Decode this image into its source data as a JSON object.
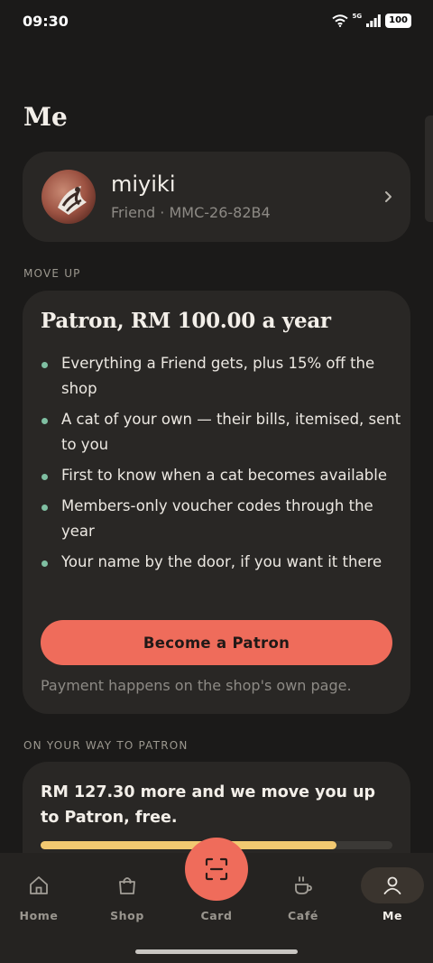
{
  "status": {
    "time": "09:30",
    "network": "5G",
    "battery": "100"
  },
  "page": {
    "title": "Me"
  },
  "profile": {
    "name": "miyiki",
    "subtitle": "Friend · MMC-26-82B4"
  },
  "move_up": {
    "label": "MOVE UP",
    "title": "Patron, RM 100.00 a year",
    "benefits": [
      "Everything a Friend gets, plus 15% off the shop",
      "A cat of your own — their bills, itemised, sent to you",
      "First to know when a cat becomes available",
      "Members-only voucher codes through the year",
      "Your name by the door, if you want it there"
    ],
    "cta_label": "Become a Patron",
    "note": "Payment happens on the shop's own page."
  },
  "progress": {
    "label": "ON YOUR WAY TO PATRON",
    "text": "RM 127.30 more and we move you up to Patron, free.",
    "fraction": 0.84
  },
  "nav": {
    "items": [
      {
        "label": "Home",
        "icon": "home-icon"
      },
      {
        "label": "Shop",
        "icon": "shopping-bag-icon"
      },
      {
        "label": "Card",
        "icon": "scan-icon"
      },
      {
        "label": "Café",
        "icon": "coffee-cup-icon"
      },
      {
        "label": "Me",
        "icon": "person-icon"
      }
    ],
    "active": "Me"
  },
  "colors": {
    "accent": "#ef6c5b",
    "progress": "#f2c971",
    "bullet": "#7fbfa2",
    "background": "#1b1a19",
    "card": "#292725"
  }
}
